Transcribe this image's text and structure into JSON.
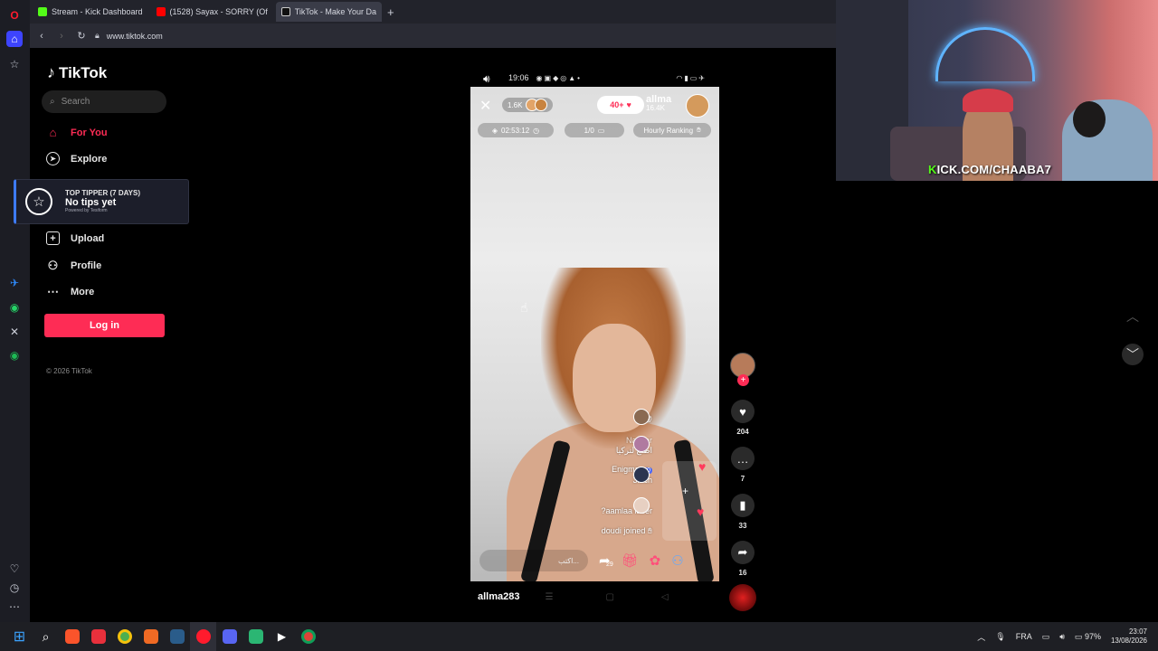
{
  "browser": {
    "tabs": [
      {
        "label": "Stream - Kick Dashboard",
        "active": false,
        "icon": "kick-icon",
        "color": "#53fc18"
      },
      {
        "label": "(1528) Sayax - SORRY (Of",
        "active": false,
        "icon": "youtube-icon",
        "color": "#ff0000"
      },
      {
        "label": "TikTok - Make Your Da",
        "active": true,
        "icon": "tiktok-icon",
        "color": "#ffffff"
      }
    ],
    "url": "www.tiktok.com"
  },
  "tiktok": {
    "brand": "TikTok",
    "search_placeholder": "Search",
    "nav": [
      {
        "label": "For You",
        "icon": "home-icon",
        "active": true
      },
      {
        "label": "Explore",
        "icon": "compass-icon",
        "active": false
      },
      {
        "label": "Upload",
        "icon": "plus-square-icon",
        "active": false
      },
      {
        "label": "Profile",
        "icon": "person-icon",
        "active": false
      },
      {
        "label": "More",
        "icon": "more-icon",
        "active": false
      }
    ],
    "login_label": "Log in",
    "copyright": "© 2026 TikTok"
  },
  "tipper": {
    "title": "TOP TIPPER (7 DAYS)",
    "value": "No tips yet",
    "powered": "Powered by Tesiform"
  },
  "phone": {
    "time": "19:06",
    "username": "allma283"
  },
  "live": {
    "viewers": "1.6K",
    "likes": "40+",
    "host_name": "allma",
    "host_followers": "16.4K",
    "duration": "02:53:12",
    "goal": "1/0",
    "ranking": "Hourly Ranking",
    "comments": [
      {
        "text": "@",
        "sub": ""
      },
      {
        "text": "Naimar",
        "sub": "اطلع لتركيا"
      },
      {
        "text": "Enigma",
        "badge": "20",
        "sub": "3lach"
      },
      {
        "text": "?aamlaa laser",
        "sub": ""
      },
      {
        "text": "doudi joined",
        "sub": ""
      }
    ],
    "type_placeholder": "اكتب...",
    "share_count": "29"
  },
  "actions": {
    "likes": "204",
    "comments": "7",
    "saves": "33",
    "shares": "16"
  },
  "webcam": {
    "overlay_k": "K",
    "overlay_rest": "ICK.COM/CHAABA7"
  },
  "system": {
    "language": "FRA",
    "battery": "97%",
    "time": "23:07",
    "date": "13/08/2026"
  }
}
